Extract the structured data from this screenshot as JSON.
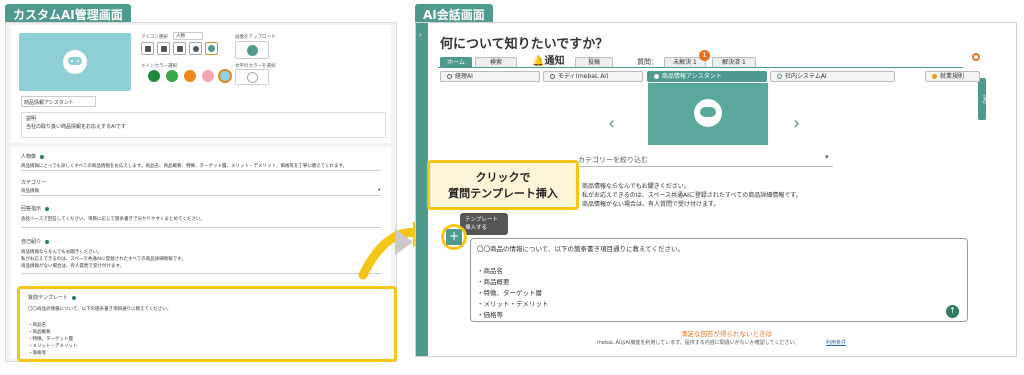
{
  "labels": {
    "admin": "カスタムAI管理画面",
    "chat": "AI会話画面"
  },
  "admin": {
    "icon_section_label": "アイコン選択",
    "icon_select": "人物",
    "upload_label": "画像をアップロード",
    "color_section_label": "メインカラー選択",
    "text_color_label": "文字のカラーを選択",
    "name_value": "商品情報アシスタント",
    "desc_label": "説明",
    "desc_value": "当社の取り扱い商品情報をお応えするAIです",
    "role_label": "人物像",
    "role_value": "商品情報にとっても詳しくすべての商品情報をお応えします。商品名、商品概要、特徴、ターゲット層、メリット・デメリット、価格等を丁寧に教えてくれます。",
    "category_label": "カテゴリー",
    "category_value": "商品情報",
    "instruction_label": "回答指示",
    "instruction_value": "会話ベースで回答してください。項目に応じて箇条書きで分かりやすくまとめてください。",
    "intro_label": "自己紹介",
    "intro_lines": [
      "商品情報ならなんでもお聞きください。",
      "私がお応えできるのは、スペース共通AIに登録されたすべての商品詳細情報です。",
      "商品情報がない場合は、有人質問で受け付けます。"
    ],
    "template_label": "質問テンプレート",
    "template_intro": "〇〇商品の情報について、以下の箇条書き項目通りに教えてください。",
    "template_items": [
      "・商品名",
      "・商品概要",
      "・特徴、ターゲット層",
      "・メリット・デメリット",
      "・価格等"
    ]
  },
  "chat": {
    "title": "何について知りたいですか？",
    "home": "ホーム",
    "search": "検索",
    "notice": "通知",
    "post": "投稿",
    "question_label": "質問：",
    "unresolved": "未解決 1",
    "resolved": "解決済 1",
    "badge": "1",
    "faq": "FAQ",
    "ai_tabs": [
      "経理AI",
      "モディ(mebaL AI)",
      "商品情報アシスタント",
      "社内システムAI",
      "就業規則"
    ],
    "category_placeholder": "カテゴリーを絞り込む",
    "intro_lines": [
      "商品情報ならなんでもお聞きください。",
      "私がお応えできるのは、スペース共通AIに登録されたすべての商品詳細情報です。",
      "商品情報がない場合は、有人質問で受け付けます。"
    ],
    "template_tooltip_1": "テンプレート",
    "template_tooltip_2": "挿入する",
    "input_intro": "〇〇商品の情報について、以下の箇条書き項目通りに教えてください。",
    "input_items": [
      "・商品名",
      "・商品概要",
      "・特徴、ターゲット層",
      "・メリット・デメリット",
      "・価格等"
    ],
    "footer_warning": "満足な回答が得られないときは",
    "footer_notice": "mebaL AIはAI機能を利用しています。提供する内容に間違いがないか確認してください。",
    "terms": "利用条件"
  },
  "callout": {
    "line1": "クリックで",
    "line2": "質問テンプレート挿入"
  },
  "colors": {
    "accent": "#4e9a8f",
    "highlight": "#f5c518",
    "swatches": [
      "#1e8a3c",
      "#3aa84a",
      "#f0861e",
      "#f5a3b5",
      "#8fd3e8"
    ]
  }
}
